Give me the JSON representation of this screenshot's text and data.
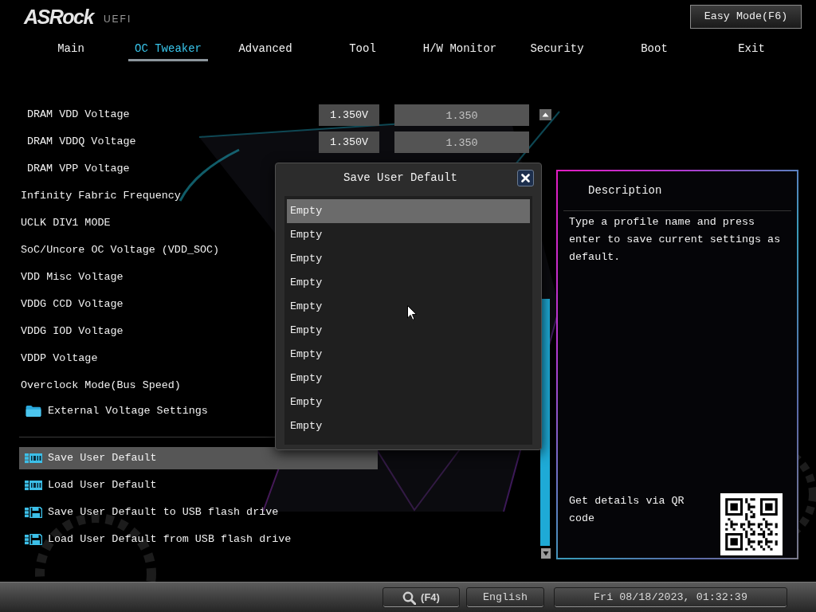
{
  "header": {
    "logo": "ASRock",
    "logo_suffix": "UEFI",
    "easy_mode_button": "Easy Mode(F6)"
  },
  "tabs": [
    {
      "label": "Main",
      "selected": false
    },
    {
      "label": "OC Tweaker",
      "selected": true
    },
    {
      "label": "Advanced",
      "selected": false
    },
    {
      "label": "Tool",
      "selected": false
    },
    {
      "label": "H/W Monitor",
      "selected": false
    },
    {
      "label": "Security",
      "selected": false
    },
    {
      "label": "Boot",
      "selected": false
    },
    {
      "label": "Exit",
      "selected": false
    }
  ],
  "settings": [
    {
      "kind": "voltage",
      "label": "DRAM VDD Voltage",
      "value": "1.350V",
      "typed_value": "1.350"
    },
    {
      "kind": "voltage",
      "label": "DRAM VDDQ Voltage",
      "value": "1.350V",
      "typed_value": "1.350"
    },
    {
      "kind": "voltage",
      "label": "DRAM VPP Voltage"
    },
    {
      "kind": "option",
      "label": "Infinity Fabric Frequency"
    },
    {
      "kind": "option",
      "label": "UCLK DIV1 MODE"
    },
    {
      "kind": "option",
      "label": "SoC/Uncore OC Voltage (VDD_SOC)"
    },
    {
      "kind": "option",
      "label": "VDD Misc Voltage"
    },
    {
      "kind": "option",
      "label": "VDDG CCD Voltage"
    },
    {
      "kind": "option",
      "label": "VDDG IOD Voltage"
    },
    {
      "kind": "option",
      "label": "VDDP Voltage"
    },
    {
      "kind": "option",
      "label": "Overclock Mode(Bus Speed)"
    },
    {
      "kind": "folder",
      "label": "External Voltage Settings"
    }
  ],
  "profile_actions": [
    {
      "kind": "bios",
      "label": "Save User Default",
      "selected": true
    },
    {
      "kind": "bios",
      "label": "Load User Default",
      "selected": false
    },
    {
      "kind": "usb",
      "label": "Save User Default to USB flash drive",
      "selected": false
    },
    {
      "kind": "usb",
      "label": "Load User Default from USB flash drive",
      "selected": false
    }
  ],
  "dialog": {
    "title": "Save User Default",
    "slots": [
      {
        "label": "Empty",
        "selected": true
      },
      {
        "label": "Empty",
        "selected": false
      },
      {
        "label": "Empty",
        "selected": false
      },
      {
        "label": "Empty",
        "selected": false
      },
      {
        "label": "Empty",
        "selected": false
      },
      {
        "label": "Empty",
        "selected": false
      },
      {
        "label": "Empty",
        "selected": false
      },
      {
        "label": "Empty",
        "selected": false
      },
      {
        "label": "Empty",
        "selected": false
      },
      {
        "label": "Empty",
        "selected": false
      }
    ]
  },
  "description": {
    "title": "Description",
    "text": "Type a profile name and press enter to save current settings as default.",
    "qr_caption": "Get details via QR code"
  },
  "status_bar": {
    "search_key": "(F4)",
    "language": "English",
    "datetime": "Fri 08/18/2023, 01:32:39"
  }
}
